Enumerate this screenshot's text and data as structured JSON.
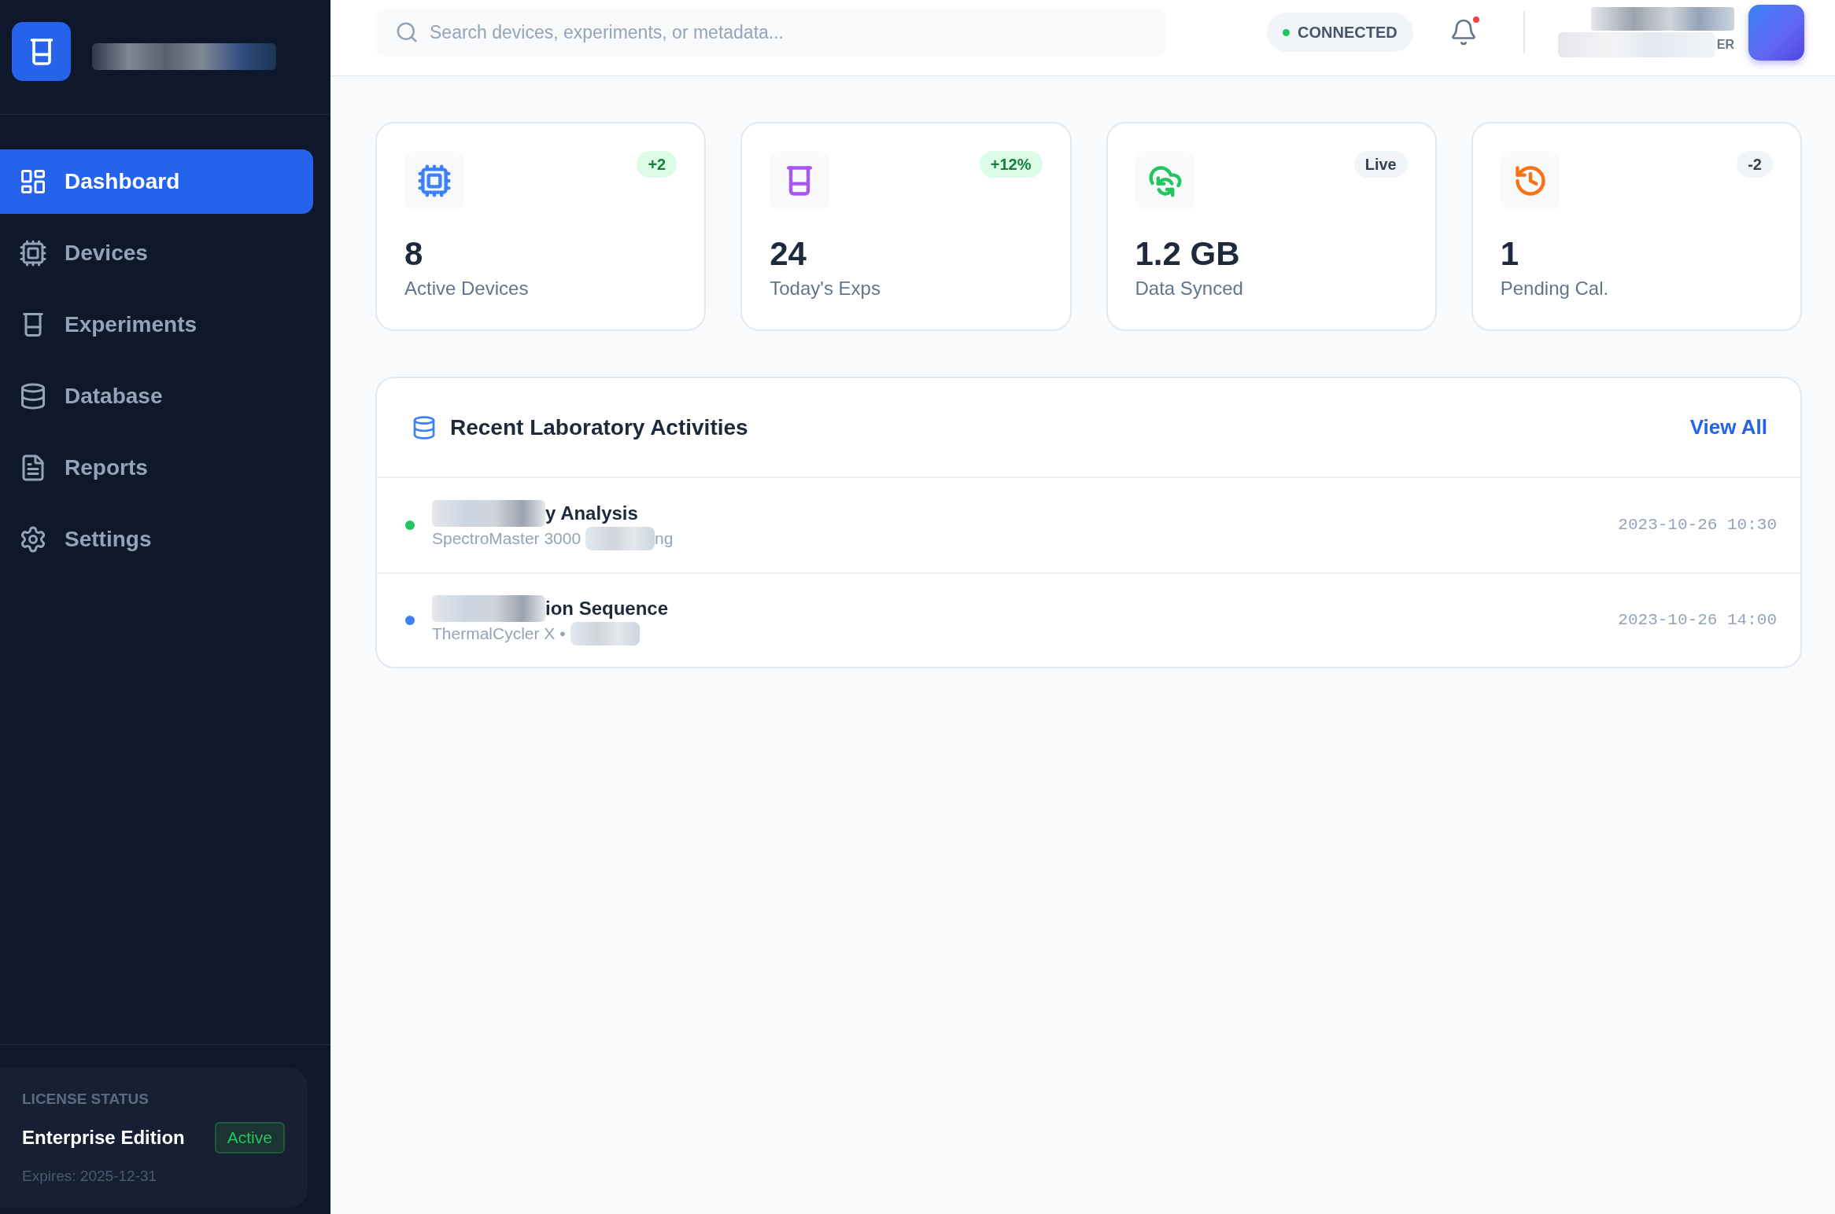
{
  "sidebar": {
    "brand": {
      "name_pixelated": true
    },
    "nav_items": [
      {
        "label": "Dashboard",
        "selected": true
      },
      {
        "label": "Devices",
        "selected": false
      },
      {
        "label": "Experiments",
        "selected": false
      },
      {
        "label": "Database",
        "selected": false
      },
      {
        "label": "Reports",
        "selected": false
      },
      {
        "label": "Settings",
        "selected": false
      }
    ],
    "license": {
      "heading": "LICENSE STATUS",
      "edition": "Enterprise Edition",
      "status": "Active",
      "expires": "Expires: 2025-12-31"
    }
  },
  "topbar": {
    "search": {
      "placeholder": "Search devices, experiments, or metadata..."
    },
    "connection": {
      "label": "CONNECTED"
    },
    "notifications": {
      "unread": true
    },
    "user": {
      "name_pixelated": true,
      "role": "ER"
    }
  },
  "stats": [
    {
      "kind": "gain",
      "value": "8",
      "label": "Active Devices",
      "badge": "+2",
      "color": "#3b82f6"
    },
    {
      "kind": "gain",
      "value": "24",
      "label": "Today's Exps",
      "badge": "+12%",
      "color": "#a855f7"
    },
    {
      "kind": "plain",
      "value": "1.2 GB",
      "label": "Data Synced",
      "badge": "Live",
      "color": "#22c55e"
    },
    {
      "kind": "plain",
      "value": "1",
      "label": "Pending Cal.",
      "badge": "-2",
      "color": "#f97316"
    }
  ],
  "activities": {
    "title": "Recent Laboratory Activities",
    "view_all": "View All",
    "rows": [
      {
        "title_pixelated": true,
        "title": "y Analysis",
        "device": "SpectroMaster 3000",
        "detail_pixelated": true,
        "detail": "ng",
        "time": "2023-10-26 10:30",
        "color": "#22c55e"
      },
      {
        "title_pixelated": true,
        "title": "ion Sequence",
        "device": "ThermalCycler X •",
        "detail_pixelated": true,
        "time": "2023-10-26 14:00",
        "color": "#3b82f6"
      }
    ]
  }
}
